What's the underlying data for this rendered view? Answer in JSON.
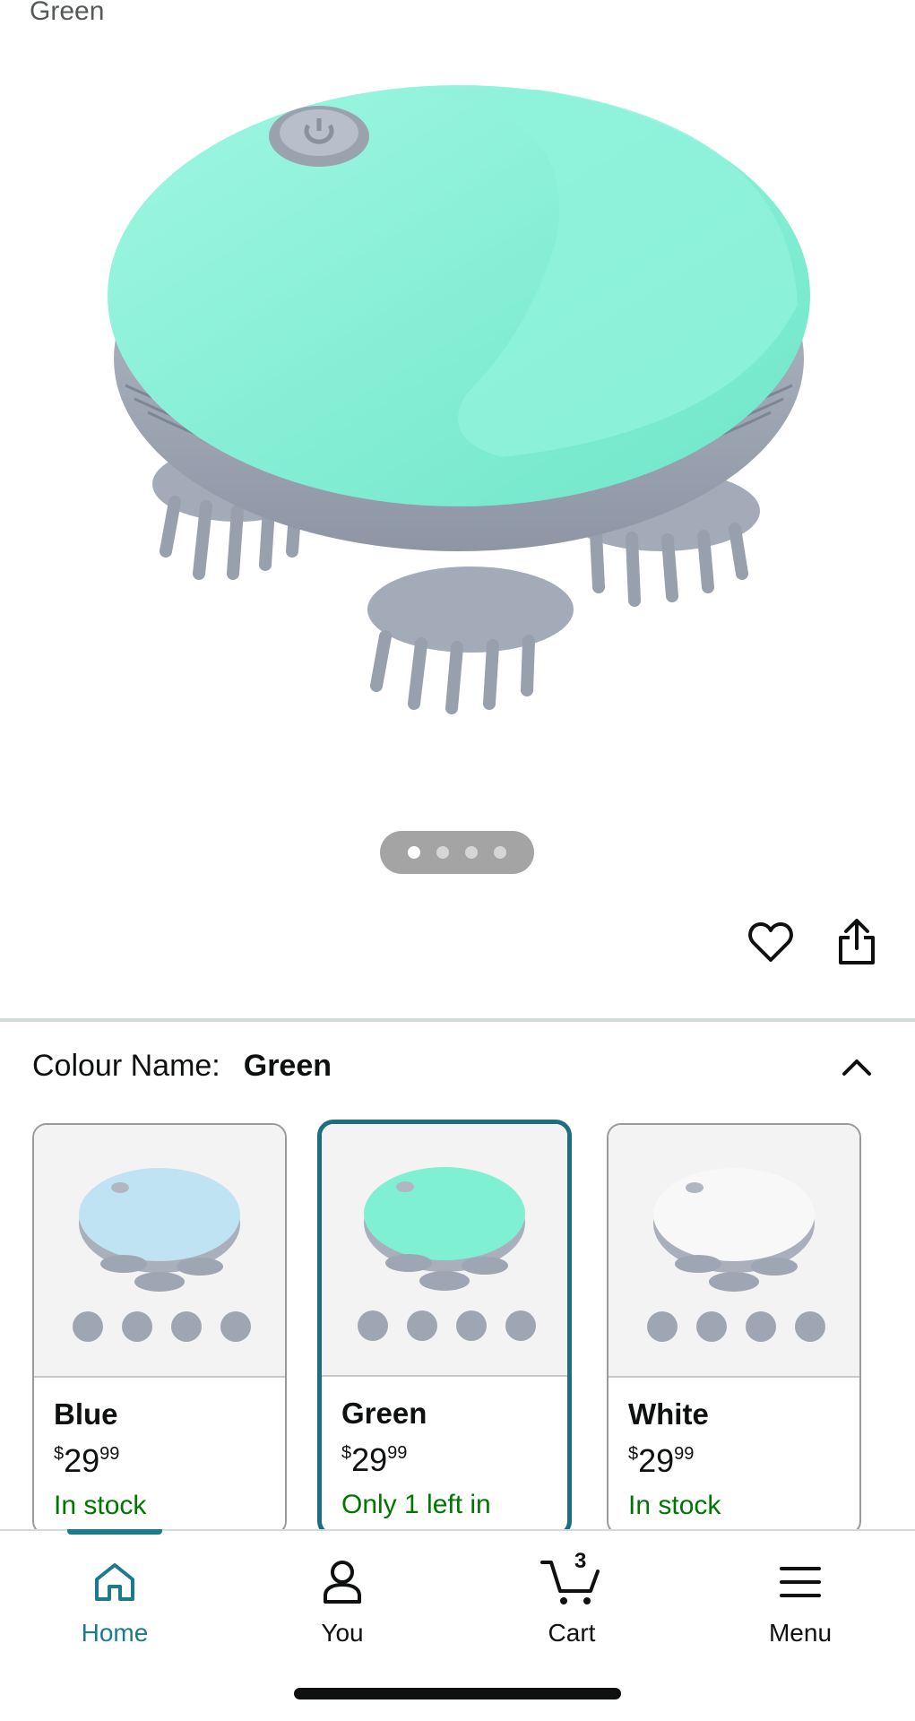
{
  "header": {
    "variant_label": "Green"
  },
  "gallery": {
    "dot_count": 4,
    "active_dot": 0,
    "image": "green-scalp-massager-with-four-heads"
  },
  "actions": {
    "favorite_icon": "heart-icon",
    "share_icon": "share-icon"
  },
  "colour": {
    "label": "Colour Name:",
    "value": "Green"
  },
  "swatches": [
    {
      "name": "Blue",
      "currency": "$",
      "price_whole": "29",
      "price_fraction": "99",
      "availability": "In stock",
      "color": "#bfe3f3",
      "selected": false
    },
    {
      "name": "Green",
      "currency": "$",
      "price_whole": "29",
      "price_fraction": "99",
      "availability": "Only 1 left in",
      "color": "#7ff0d2",
      "selected": true
    },
    {
      "name": "White",
      "currency": "$",
      "price_whole": "29",
      "price_fraction": "99",
      "availability": "In stock",
      "color": "#f8f8f8",
      "selected": false
    }
  ],
  "nav": {
    "home": "Home",
    "you": "You",
    "cart": "Cart",
    "cart_count": "3",
    "menu": "Menu"
  },
  "colors": {
    "accent": "#1b7b8a",
    "in_stock": "#007600",
    "product": "#86f1d8",
    "grey_plastic": "#a6aebb"
  }
}
